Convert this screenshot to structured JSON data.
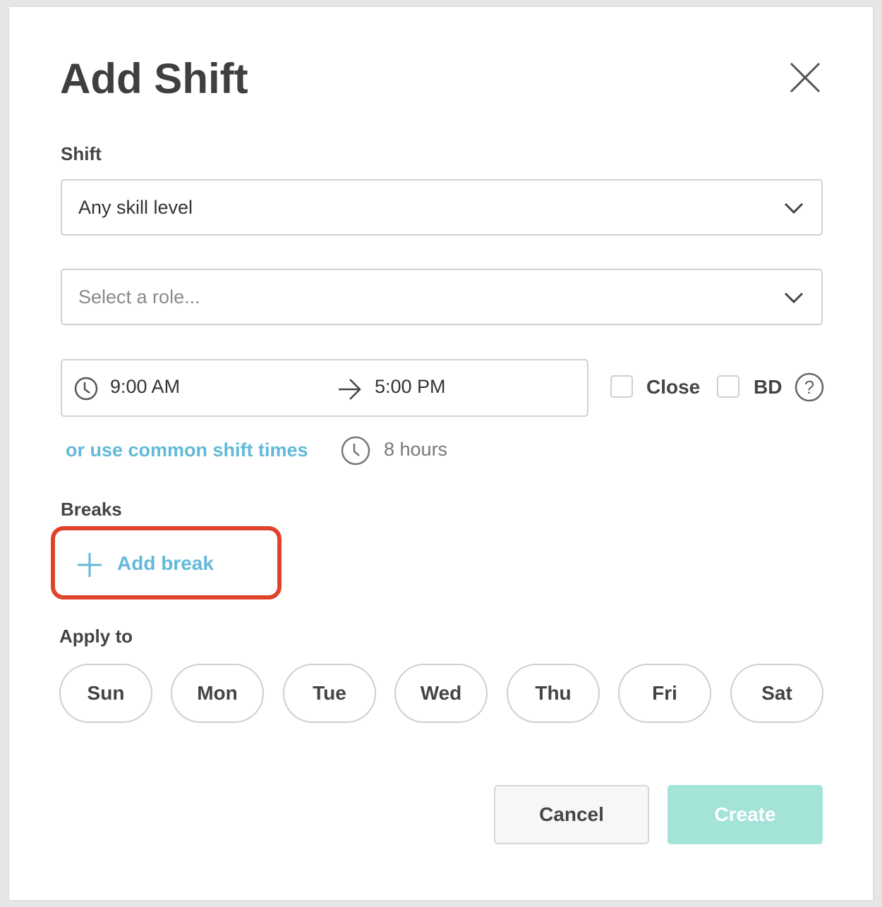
{
  "modal": {
    "title": "Add Shift"
  },
  "shift_section": {
    "label": "Shift",
    "skill_select": {
      "value": "Any skill level"
    },
    "role_select": {
      "placeholder": "Select a role..."
    }
  },
  "time": {
    "start": "9:00 AM",
    "end": "5:00 PM",
    "close_label": "Close",
    "bd_label": "BD",
    "common_link": "or use common shift times",
    "duration": "8 hours"
  },
  "breaks": {
    "label": "Breaks",
    "add_label": "Add break"
  },
  "apply": {
    "label": "Apply to",
    "days": [
      "Sun",
      "Mon",
      "Tue",
      "Wed",
      "Thu",
      "Fri",
      "Sat"
    ]
  },
  "actions": {
    "cancel": "Cancel",
    "create": "Create"
  },
  "colors": {
    "link": "#63b9d8",
    "create_button": "#a3e3d8",
    "highlight": "#e0432b"
  },
  "icons": {
    "close": "close-icon",
    "chevron": "chevron-down-icon",
    "clock": "clock-icon",
    "arrow": "arrow-right-icon",
    "help": "help-icon",
    "plus": "plus-icon"
  }
}
